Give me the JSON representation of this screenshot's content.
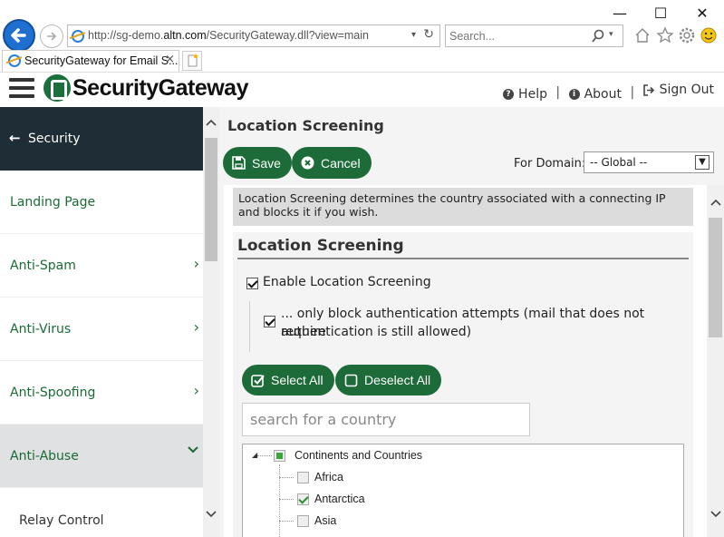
{
  "browser": {
    "url_prefix": "http://sg-demo.",
    "url_domain": "altn.com",
    "url_path": "/SecurityGateway.dll?view=main",
    "search_placeholder": "Search...",
    "tab_title": "SecurityGateway for Email S...",
    "tab_close": "×",
    "window_controls": {
      "minimize": "—",
      "maximize": "☐",
      "close": "✕"
    }
  },
  "header": {
    "logo_text": "SecurityGateway",
    "help_label": "Help",
    "about_label": "About",
    "signout_label": "Sign Out",
    "separator": "|"
  },
  "sidebar": {
    "back_label": "Security",
    "items": [
      {
        "label": "Landing Page",
        "has_chevron": false
      },
      {
        "label": "Anti-Spam",
        "chevron": "›"
      },
      {
        "label": "Anti-Virus",
        "chevron": "›"
      },
      {
        "label": "Anti-Spoofing",
        "chevron": "›"
      },
      {
        "label": "Anti-Abuse",
        "chevron": "⌄"
      }
    ],
    "sub_item": "Relay Control"
  },
  "main": {
    "page_title": "Location Screening",
    "save_label": "Save",
    "cancel_label": "Cancel",
    "domain_label": "For Domain:",
    "domain_value": "-- Global --",
    "description": "Location Screening determines the country associated with a connecting IP and blocks it if you wish.",
    "panel_title": "Location Screening",
    "enable_label": "Enable Location Screening",
    "enable_checked": true,
    "auth_only_label_line1": "... only block authentication attempts (mail that does not require",
    "auth_only_label_line2": "authentication is still allowed)",
    "auth_only_checked": true,
    "select_all_label": "Select All",
    "deselect_all_label": "Deselect All",
    "country_search_placeholder": "search for a country",
    "tree": {
      "root": "Continents and Countries",
      "children": [
        {
          "label": "Africa",
          "state": "unchecked"
        },
        {
          "label": "Antarctica",
          "state": "checked"
        },
        {
          "label": "Asia",
          "state": "unchecked"
        }
      ]
    }
  },
  "colors": {
    "accent_green": "#1d6b38",
    "sidebar_header": "#1e2d36",
    "browser_blue": "#1e6fd0"
  }
}
